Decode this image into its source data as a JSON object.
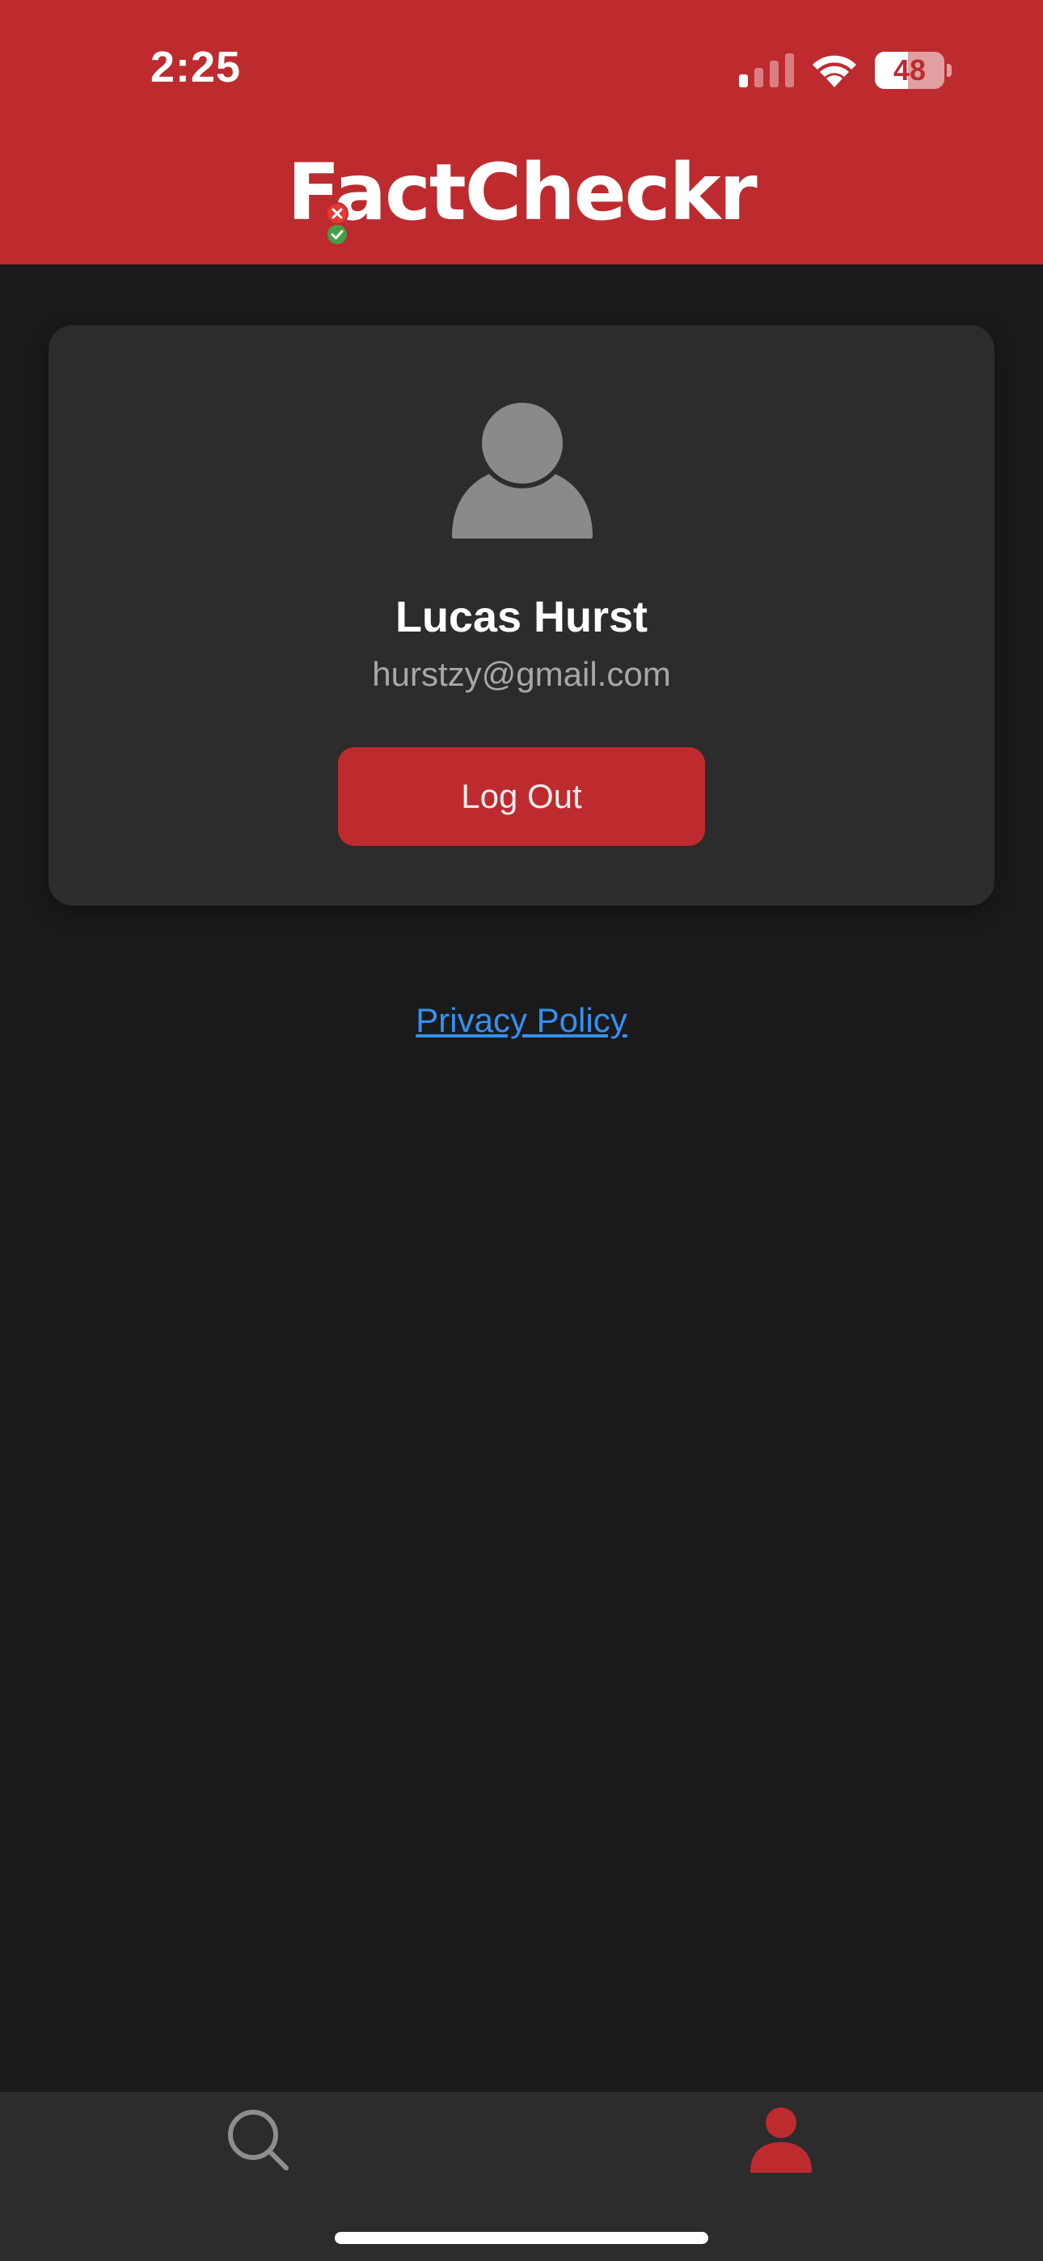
{
  "status_bar": {
    "time": "2:25",
    "battery_level": "48",
    "battery_fraction": 0.48,
    "signal_bars_active": 1,
    "signal_bars_total": 4
  },
  "header": {
    "app_title": "FactCheckr",
    "background_color": "#bd2b2f"
  },
  "profile": {
    "name": "Lucas Hurst",
    "email": "hurstzy@gmail.com",
    "logout_label": "Log Out"
  },
  "links": {
    "privacy_policy": "Privacy Policy"
  },
  "tab_bar": {
    "tabs": [
      {
        "icon": "search-icon",
        "active": false
      },
      {
        "icon": "profile-icon",
        "active": true
      }
    ],
    "active_color": "#bd2b2f",
    "inactive_color": "#8e8e8e"
  }
}
